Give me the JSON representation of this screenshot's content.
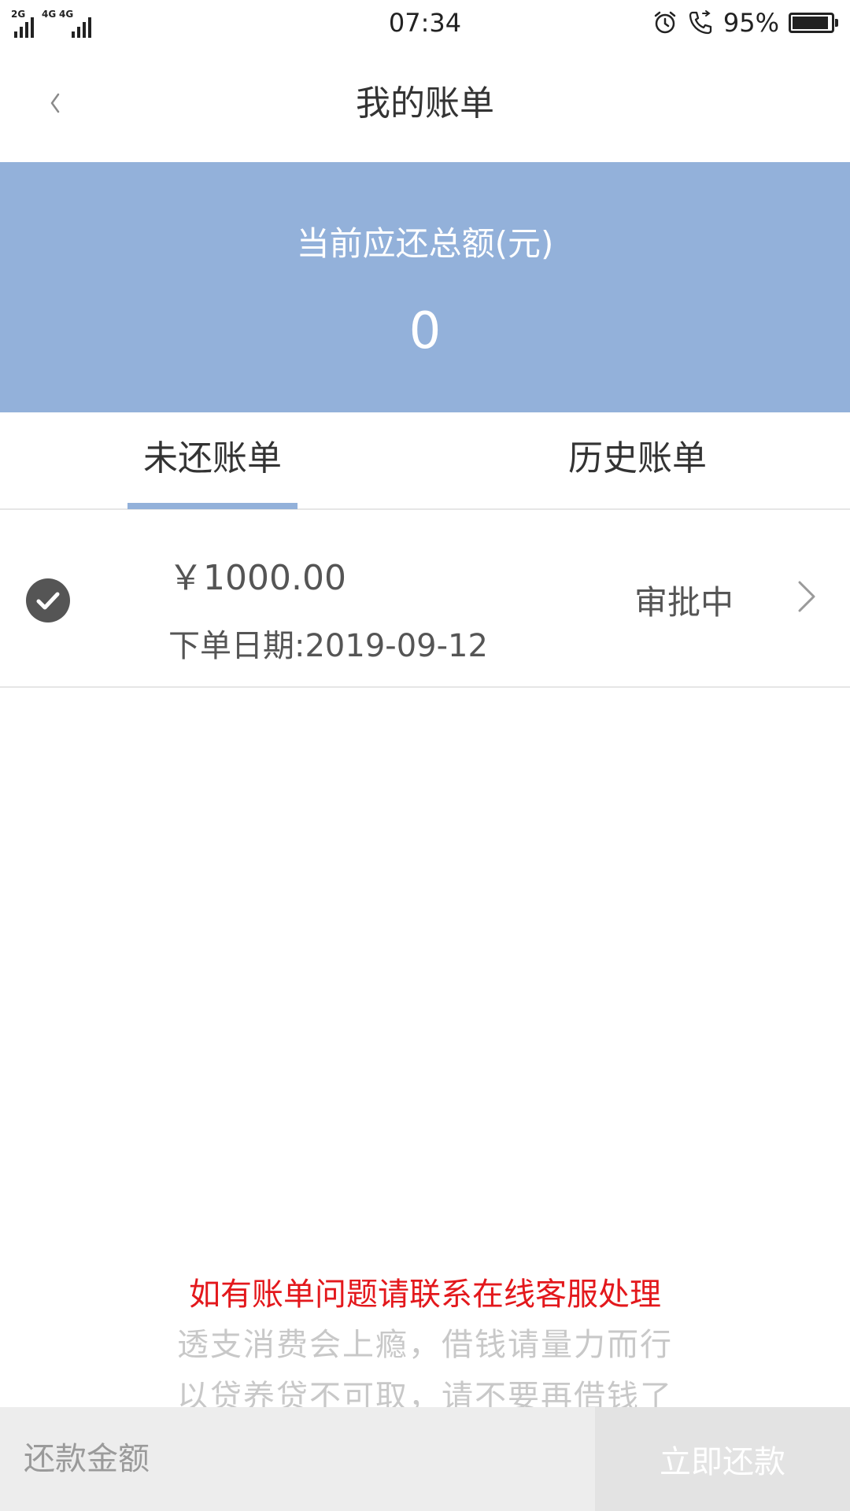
{
  "status_bar": {
    "network_1": "2G",
    "network_2": "4G",
    "network_3": "4G",
    "time": "07:34",
    "battery_percent": "95%",
    "battery_level": 0.95,
    "icons": [
      "signal-icon",
      "alarm-icon",
      "call-icon",
      "battery-icon"
    ]
  },
  "header": {
    "title": "我的账单",
    "back_icon": "chevron-left-icon"
  },
  "summary": {
    "label": "当前应还总额(元)",
    "amount": "0",
    "background": "#93b1da"
  },
  "tabs": [
    {
      "label": "未还账单",
      "active": true
    },
    {
      "label": "历史账单",
      "active": false
    }
  ],
  "bills": [
    {
      "amount": "￥1000.00",
      "date": "下单日期:2019-09-12",
      "status": "审批中",
      "icon": "check-circle-icon"
    }
  ],
  "notices": {
    "primary": "如有账单问题请联系在线客服处理",
    "primary_color": "#e3181c",
    "line1": "透支消费会上瘾，借钱请量力而行",
    "line2": "以贷养贷不可取，请不要再借钱了"
  },
  "repay": {
    "input_placeholder": "还款金额",
    "button_label": "立即还款"
  }
}
